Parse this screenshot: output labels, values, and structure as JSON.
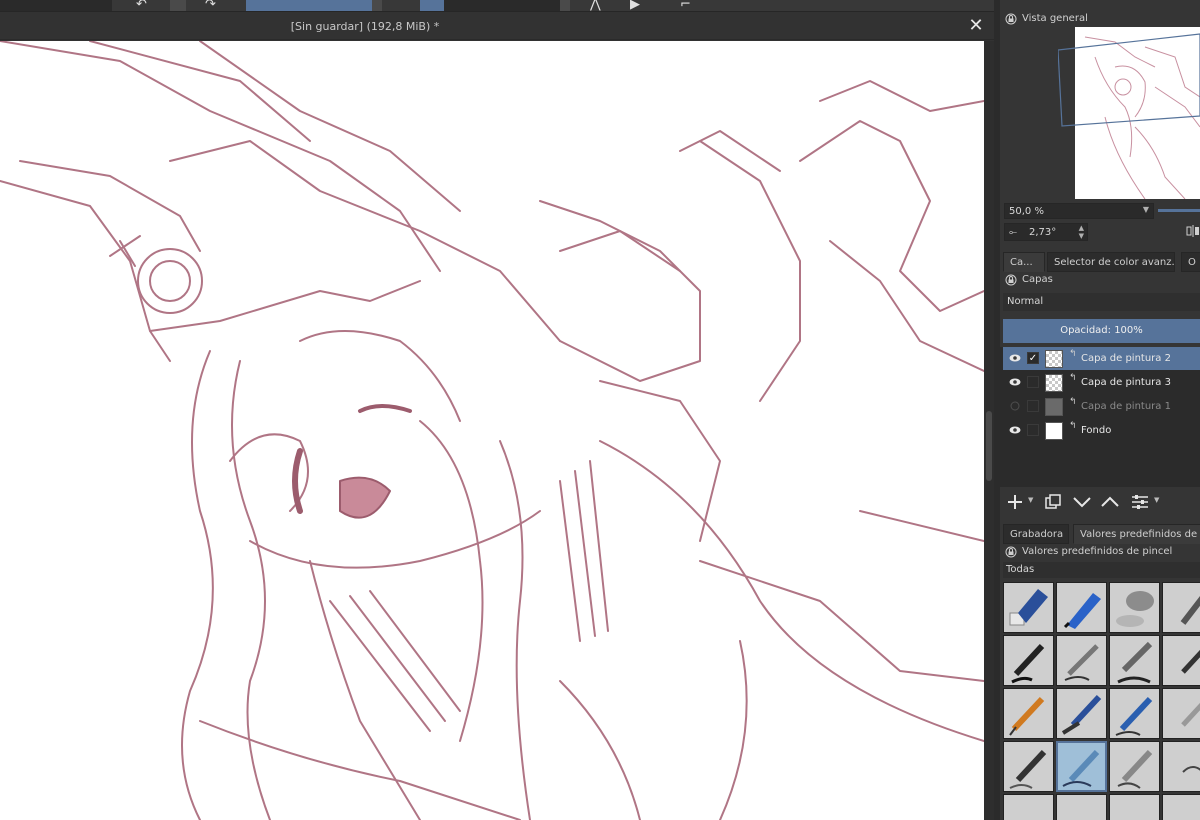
{
  "document": {
    "title": "[Sin guardar]  (192,8 MiB) *"
  },
  "overview": {
    "title": "Vista general",
    "zoom": "50,0 %",
    "rotation": "2,73°"
  },
  "tabs": {
    "top": [
      "Ca...",
      "Selector de color avanz...",
      "O"
    ],
    "bottom": [
      "Grabadora",
      "Valores predefinidos de p"
    ]
  },
  "layers_panel": {
    "title": "Capas",
    "blend_mode": "Normal",
    "opacity_label": "Opacidad:  100%",
    "layers": [
      {
        "name": "Capa de pintura 2",
        "visible": true,
        "selected": true
      },
      {
        "name": "Capa de pintura 3",
        "visible": true,
        "selected": false
      },
      {
        "name": "Capa de pintura 1",
        "visible": false,
        "selected": false
      },
      {
        "name": "Fondo",
        "visible": true,
        "selected": false
      }
    ]
  },
  "brush_presets": {
    "title": "Valores predefinidos de pincel",
    "filter": "Todas"
  },
  "colors": {
    "accent": "#56739a",
    "sketch_stroke": "#b07585",
    "panel_bg": "#353535"
  }
}
